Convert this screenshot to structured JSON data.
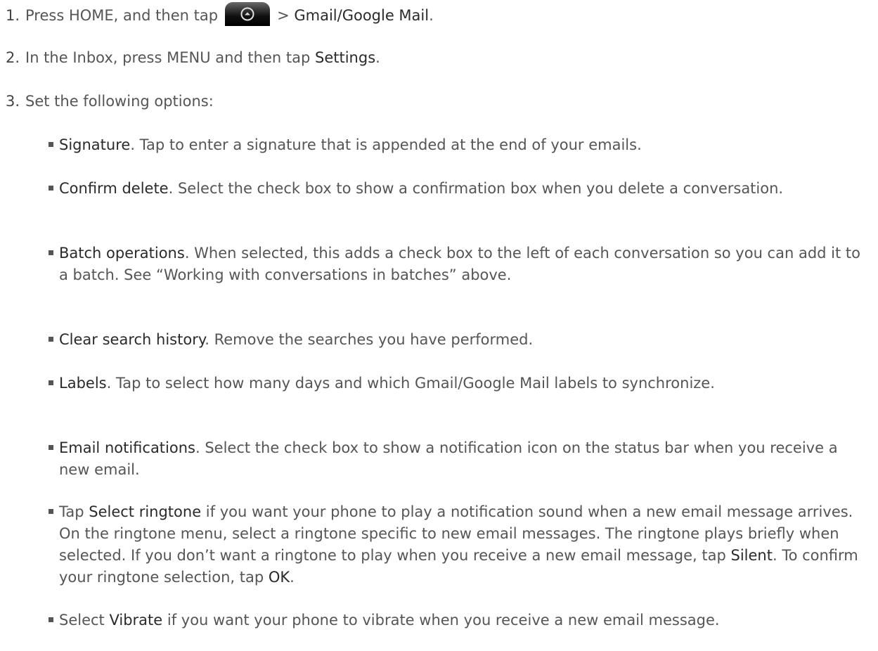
{
  "steps": [
    {
      "num": "1.",
      "before": "Press HOME, and then tap",
      "after_icon": "> ",
      "em": "Gmail/Google Mail",
      "tail": "."
    },
    {
      "num": "2.",
      "before": "In the Inbox, press MENU and then tap ",
      "em": "Settings",
      "tail": "."
    },
    {
      "num": "3.",
      "text": "Set the following options:"
    }
  ],
  "icons": {
    "home_button": "all-apps-home-icon"
  },
  "options": [
    {
      "parts": [
        {
          "t": "Signature",
          "em": true
        },
        {
          "t": ". Tap to enter a signature that is appended at the end of your emails.",
          "em": false
        }
      ]
    },
    {
      "parts": [
        {
          "t": "Confirm delete",
          "em": true
        },
        {
          "t": ". Select the check box to show a confirmation box when you delete a conversation.",
          "em": false
        }
      ]
    },
    {
      "parts": [
        {
          "t": "Batch operations",
          "em": true
        },
        {
          "t": ". When selected, this adds a check box to the left of each conversation so you can add it to a batch. See “Working with conversations in batches” above.",
          "em": false
        }
      ]
    },
    {
      "parts": [
        {
          "t": "Clear search history",
          "em": true
        },
        {
          "t": ". Remove the searches you have performed.",
          "em": false
        }
      ]
    },
    {
      "parts": [
        {
          "t": "Labels",
          "em": true
        },
        {
          "t": ". Tap to select how many days and which Gmail/Google Mail labels to synchronize.",
          "em": false
        }
      ]
    },
    {
      "parts": [
        {
          "t": "Email notifications",
          "em": true
        },
        {
          "t": ". Select the check box to show a notification icon on the status bar when you receive a new email.",
          "em": false
        }
      ]
    },
    {
      "parts": [
        {
          "t": "Tap ",
          "em": false
        },
        {
          "t": "Select ringtone",
          "em": true
        },
        {
          "t": " if you want your phone to play a notification sound when a new email message arrives. On the ringtone menu, select a ringtone specific to new email messages. The ringtone plays briefly when selected. If you don’t want a ringtone to play when you receive a new email message, tap ",
          "em": false
        },
        {
          "t": "Silent",
          "em": true
        },
        {
          "t": ". To confirm your ringtone selection, tap ",
          "em": false
        },
        {
          "t": "OK",
          "em": true
        },
        {
          "t": ".",
          "em": false
        }
      ]
    },
    {
      "parts": [
        {
          "t": "Select ",
          "em": false
        },
        {
          "t": "Vibrate",
          "em": true
        },
        {
          "t": " if you want your phone to vibrate when you receive a new email message.",
          "em": false
        }
      ]
    }
  ]
}
